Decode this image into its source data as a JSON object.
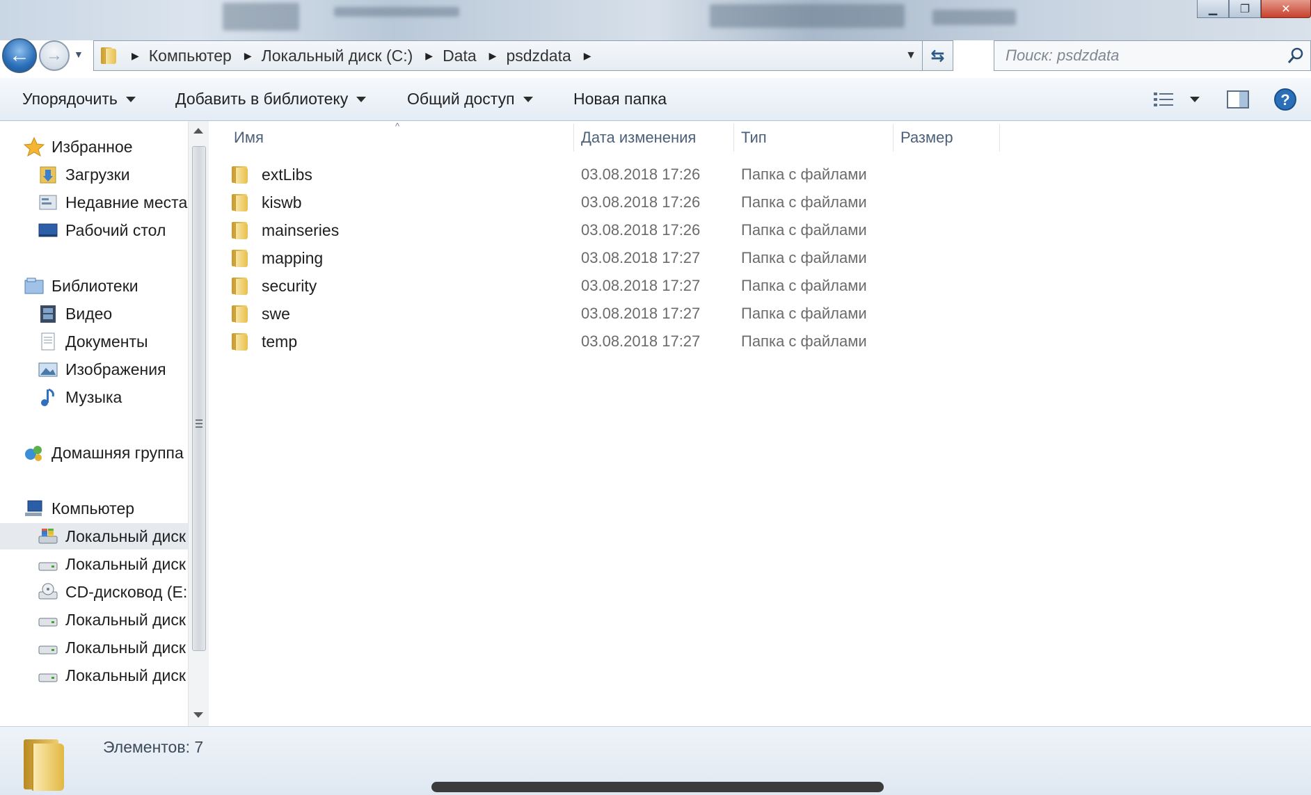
{
  "window": {
    "controls": {
      "minimize": "▁",
      "maximize": "❐",
      "close": "✕"
    }
  },
  "navigation": {
    "back_icon": "arrow-left-icon",
    "forward_icon": "arrow-right-icon",
    "breadcrumb": [
      "Компьютер",
      "Локальный диск (C:)",
      "Data",
      "psdzdata"
    ],
    "search_placeholder": "Поиск: psdzdata"
  },
  "toolbar": {
    "organize": "Упорядочить",
    "add_to_library": "Добавить в библиотеку",
    "share": "Общий доступ",
    "new_folder": "Новая папка"
  },
  "sidebar": {
    "favorites": {
      "label": "Избранное",
      "items": [
        "Загрузки",
        "Недавние места",
        "Рабочий стол"
      ]
    },
    "libraries": {
      "label": "Библиотеки",
      "items": [
        "Видео",
        "Документы",
        "Изображения",
        "Музыка"
      ]
    },
    "homegroup": {
      "label": "Домашняя группа"
    },
    "computer": {
      "label": "Компьютер",
      "items": [
        "Локальный диск",
        "Локальный диск",
        "CD-дисковод (E:",
        "Локальный диск",
        "Локальный диск",
        "Локальный диск"
      ]
    }
  },
  "columns": {
    "name": "Имя",
    "date": "Дата изменения",
    "type": "Тип",
    "size": "Размер"
  },
  "files": [
    {
      "name": "extLibs",
      "date": "03.08.2018 17:26",
      "type": "Папка с файлами"
    },
    {
      "name": "kiswb",
      "date": "03.08.2018 17:26",
      "type": "Папка с файлами"
    },
    {
      "name": "mainseries",
      "date": "03.08.2018 17:26",
      "type": "Папка с файлами"
    },
    {
      "name": "mapping",
      "date": "03.08.2018 17:27",
      "type": "Папка с файлами"
    },
    {
      "name": "security",
      "date": "03.08.2018 17:27",
      "type": "Папка с файлами"
    },
    {
      "name": "swe",
      "date": "03.08.2018 17:27",
      "type": "Папка с файлами"
    },
    {
      "name": "temp",
      "date": "03.08.2018 17:27",
      "type": "Папка с файлами"
    }
  ],
  "details": {
    "count_text": "Элементов: 7"
  },
  "colors": {
    "accent": "#2a6fb8",
    "folder": "#e8bf4c",
    "header_text": "#4c607a"
  }
}
